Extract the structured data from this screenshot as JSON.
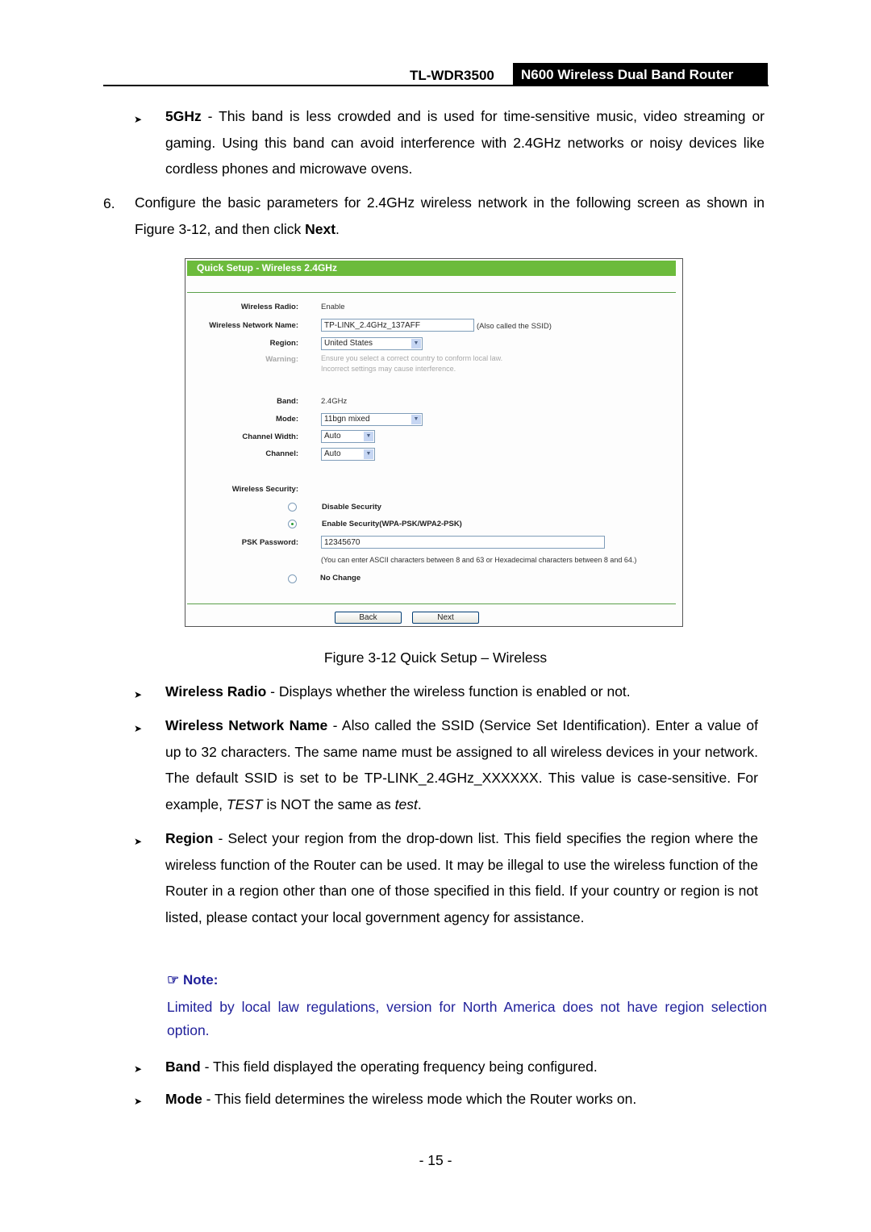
{
  "header": {
    "model": "TL-WDR3500",
    "product": "N600 Wireless Dual Band Router"
  },
  "intro": {
    "bullet_5ghz_term": "5GHz",
    "bullet_5ghz_text": " - This band is less crowded and is used for time-sensitive music, video streaming or gaming. Using this band can avoid interference with 2.4GHz networks or noisy devices like cordless phones and microwave ovens.",
    "step_number": "6.",
    "step_text_before": "Configure the basic parameters for 2.4GHz wireless network in the following screen as shown in Figure 3-12, and then click ",
    "step_text_bold": "Next",
    "step_text_after": "."
  },
  "figure": {
    "title": "Quick Setup - Wireless 2.4GHz",
    "fields": {
      "wireless_radio_label": "Wireless Radio:",
      "wireless_radio_value": "Enable",
      "network_name_label": "Wireless Network Name:",
      "network_name_value": "TP-LINK_2.4GHz_137AFF",
      "network_name_hint": "(Also called the SSID)",
      "region_label": "Region:",
      "region_value": "United States",
      "warning_label": "Warning:",
      "warning_line1": "Ensure you select a correct country to conform local law.",
      "warning_line2": "Incorrect settings may cause interference.",
      "band_label": "Band:",
      "band_value": "2.4GHz",
      "mode_label": "Mode:",
      "mode_value": "11bgn mixed",
      "channel_width_label": "Channel Width:",
      "channel_width_value": "Auto",
      "channel_label": "Channel:",
      "channel_value": "Auto",
      "security_label": "Wireless Security:",
      "disable_security": "Disable Security",
      "enable_security": "Enable Security(WPA-PSK/WPA2-PSK)",
      "psk_label": "PSK Password:",
      "psk_value": "12345670",
      "psk_hint": "(You can enter ASCII characters between 8 and 63 or Hexadecimal characters between 8 and 64.)",
      "no_change": "No Change",
      "selected_security": "enable"
    },
    "buttons": {
      "back": "Back",
      "next": "Next"
    },
    "caption": "Figure 3-12 Quick Setup – Wireless"
  },
  "definitions": [
    {
      "term": "Wireless Radio",
      "text": " - Displays whether the wireless function is enabled or not."
    },
    {
      "term": "Wireless Network Name",
      "text": " - Also called the SSID (Service Set Identification). Enter a value of up to 32 characters. The same name must be assigned to all wireless devices in your network. The default SSID is set to be TP-LINK_2.4GHz_XXXXXX. This value is case-sensitive. For example, ",
      "italic1": "TEST",
      "mid": " is NOT the same as ",
      "italic2": "test",
      "end": "."
    },
    {
      "term": "Region",
      "text": " - Select your region from the drop-down list. This field specifies the region where the wireless function of the Router can be used. It may be illegal to use the wireless function of the Router in a region other than one of those specified in this field. If your country or region is not listed, please contact your local government agency for assistance."
    },
    {
      "term": "Band",
      "text": " - This field displayed the operating frequency being configured."
    },
    {
      "term": "Mode",
      "text": " - This field determines the wireless mode which the Router works on."
    }
  ],
  "note": {
    "icon": "pointing-hand-icon",
    "label": "Note:",
    "text": "Limited by local law regulations, version for North America does not have region selection option."
  },
  "page_number": "- 15 -",
  "colors": {
    "title_bar": "#6cbb3c",
    "note_blue": "#1f1f9a"
  }
}
